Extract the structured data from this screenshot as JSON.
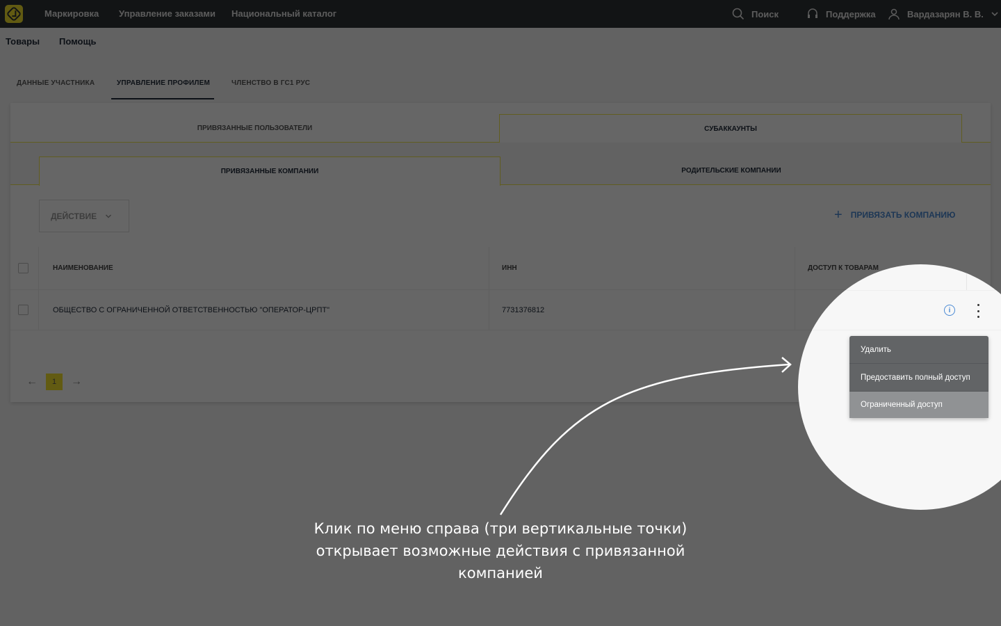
{
  "topbar": {
    "nav": [
      "Маркировка",
      "Управление заказами",
      "Национальный каталог"
    ],
    "search_label": "Поиск",
    "support_label": "Поддержка",
    "user_name": "Вардазарян В. В."
  },
  "subnav": [
    "Товары",
    "Помощь"
  ],
  "profile_tabs": [
    "ДАННЫЕ УЧАСТНИКА",
    "УПРАВЛЕНИЕ ПРОФИЛЕМ",
    "ЧЛЕНСТВО В ГС1 РУС"
  ],
  "section_tabs": [
    "ПРИВЯЗАННЫЕ ПОЛЬЗОВАТЕЛИ",
    "СУБАККАУНТЫ"
  ],
  "subaccount_tabs": [
    "ПРИВЯЗАННЫЕ КОМПАНИИ",
    "РОДИТЕЛЬСКИЕ КОМПАНИИ"
  ],
  "toolbar": {
    "action_label": "ДЕЙСТВИЕ",
    "link_company_label": "ПРИВЯЗАТЬ КОМПАНИЮ"
  },
  "table": {
    "headers": [
      "НАИМЕНОВАНИЕ",
      "ИНН",
      "ДОСТУП К ТОВАРАМ"
    ],
    "rows": [
      {
        "name": "ОБЩЕСТВО С ОГРАНИЧЕННОЙ ОТВЕТСТВЕННОСТЬЮ \"ОПЕРАТОР-ЦРПТ\"",
        "inn": "7731376812"
      }
    ]
  },
  "pager": {
    "current_page": "1"
  },
  "context_menu": [
    "Удалить",
    "Предоставить полный доступ",
    "Ограниченный доступ"
  ],
  "caption": "Клик по меню справа (три вертикальные точки) открывает возможные действия с привязанной компанией",
  "colors": {
    "accent": "#f6e32f",
    "link": "#4a8ad4",
    "topbar": "#2f3336"
  }
}
